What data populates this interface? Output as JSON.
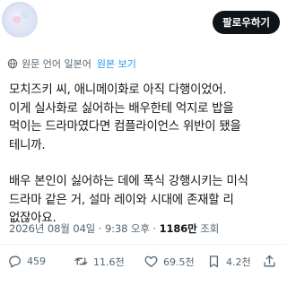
{
  "header": {
    "follow_label": "팔로우하기"
  },
  "translation": {
    "info_text": "원문 언어 일본어",
    "view_original_label": "원본 보기"
  },
  "post": {
    "paragraph1": [
      "모치즈키 씨, 애니메이화로 아직 다행이었어.",
      "이게 실사화로 싫어하는 배우한테 억지로 밥을",
      "먹이는 드라마였다면 컴플라이언스 위반이 됐을",
      "테니까."
    ],
    "paragraph2": [
      "배우 본인이 싫어하는 데에 폭식 강행시키는 미식",
      "드라마 같은 거, 설마 레이와 시대에 존재할 리",
      "없잖아요."
    ],
    "timestamp": "2026년 08월 04일 · 9:38 오후 · ",
    "views_count": "1186만",
    "views_label": " 조회"
  },
  "actions": {
    "replies": "459",
    "reposts": "11.6천",
    "likes": "69.5천",
    "bookmarks": "4.2천"
  },
  "colors": {
    "text": "#0f1419",
    "secondary": "#536471",
    "link": "#1d9bf0",
    "button_bg": "#0f1419"
  }
}
